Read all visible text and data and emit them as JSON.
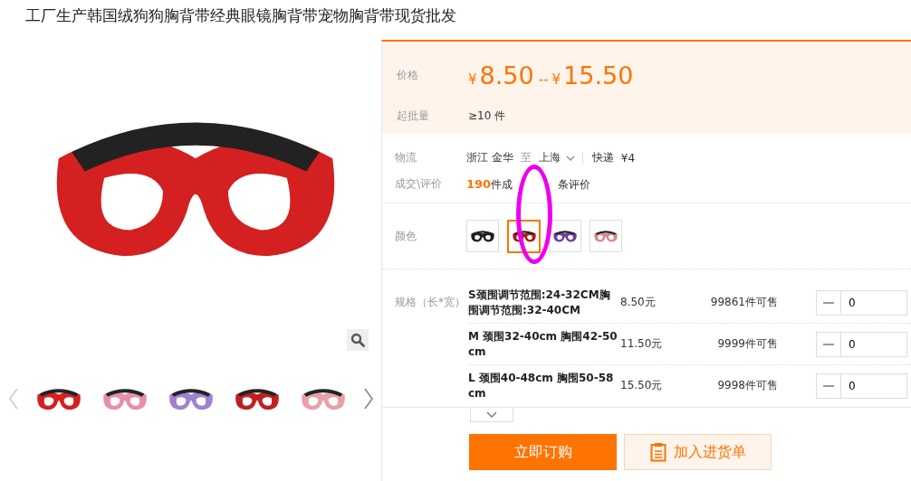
{
  "title": "工厂生产韩国绒狗狗胸背带经典眼镜胸背带宠物胸背带现货批发",
  "gallery": {
    "thumbnails": [
      {
        "selected": false
      },
      {
        "selected": false
      },
      {
        "selected": false
      },
      {
        "selected": false
      },
      {
        "selected": false
      }
    ]
  },
  "price": {
    "label": "价格",
    "currency_low": "¥",
    "low": "8.50",
    "separator": "--",
    "currency_high": "¥",
    "high": "15.50"
  },
  "min_order": {
    "label": "起批量",
    "value": "≥10 件"
  },
  "logistics": {
    "label": "物流",
    "origin": "浙江 金华",
    "to": "至",
    "destination": "上海",
    "method": "快递",
    "fee": "¥4"
  },
  "deals": {
    "label": "成交\\评价",
    "sold_count": "190",
    "sold_text": "件成",
    "review_text": "条评价"
  },
  "colors": {
    "label": "颜色",
    "swatches": [
      {
        "color": "#202020",
        "selected": false
      },
      {
        "color": "#b01818",
        "selected": true
      },
      {
        "color": "#6a40a0",
        "selected": false
      },
      {
        "color": "#d88890",
        "selected": false
      }
    ]
  },
  "specs": {
    "label": "规格（长*宽）",
    "rows": [
      {
        "name": "S颈围调节范围:24-32CM胸围调节范围:32-40CM",
        "price": "8.50元",
        "stock": "99861",
        "stock_text": "件可售",
        "quantity": "0"
      },
      {
        "name": "M 颈围32-40cm 胸围42-50cm",
        "price": "11.50元",
        "stock": "9999",
        "stock_text": "件可售",
        "quantity": "0"
      },
      {
        "name": "L 颈围40-48cm 胸围50-58cm",
        "price": "15.50元",
        "stock": "9998",
        "stock_text": "件可售",
        "quantity": "0"
      }
    ]
  },
  "buttons": {
    "order": "立即订购",
    "cart": "加入进货单"
  }
}
